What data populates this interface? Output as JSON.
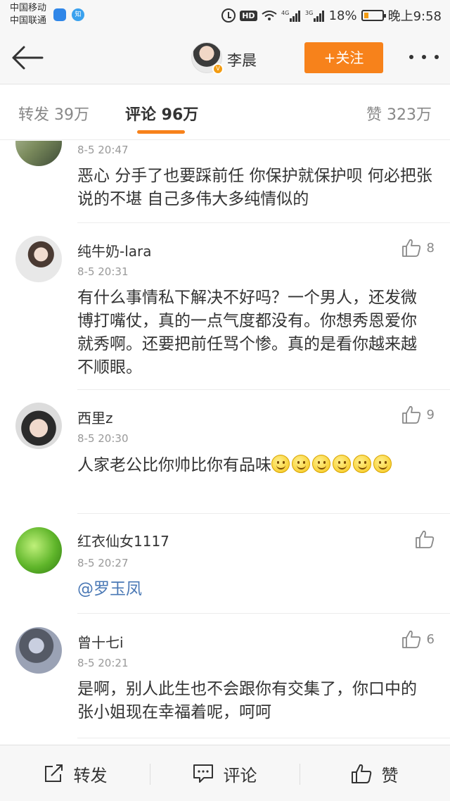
{
  "status_bar": {
    "carrier1": "中国移动",
    "carrier2": "中国联通",
    "zhi_badge": "知",
    "hd": "HD",
    "net1": "4G",
    "net2": "3G",
    "battery": "18%",
    "time": "晚上9:58"
  },
  "nav": {
    "title": "李晨",
    "follow_label": "+关注"
  },
  "tabs": {
    "repost": "转发 39万",
    "comments": "评论 96万",
    "likes": "赞 323万"
  },
  "comments": [
    {
      "time": "8-5 20:47",
      "text": "恶心 分手了也要踩前任 你保护就保护呗 何必把张说的不堪 自己多伟大多纯情似的"
    },
    {
      "user": "纯牛奶-lara",
      "time": "8-5 20:31",
      "likes": "8",
      "text": "有什么事情私下解决不好吗？一个男人，还发微博打嘴仗，真的一点气度都没有。你想秀恩爱你就秀啊。还要把前任骂个惨。真的是看你越来越不顺眼。"
    },
    {
      "user": "西里z",
      "time": "8-5 20:30",
      "likes": "9",
      "text": "人家老公比你帅比你有品味"
    },
    {
      "user": "红衣仙女1117",
      "time": "8-5 20:27",
      "text": "@罗玉凤"
    },
    {
      "user": "曾十七i",
      "time": "8-5 20:21",
      "likes": "6",
      "text": "是啊，别人此生也不会跟你有交集了，你口中的张小姐现在幸福着呢，呵呵"
    }
  ],
  "toolbar": {
    "repost": "转发",
    "comment": "评论",
    "like": "赞"
  },
  "colors": {
    "accent": "#f7821b",
    "mention": "#4a78b5"
  }
}
